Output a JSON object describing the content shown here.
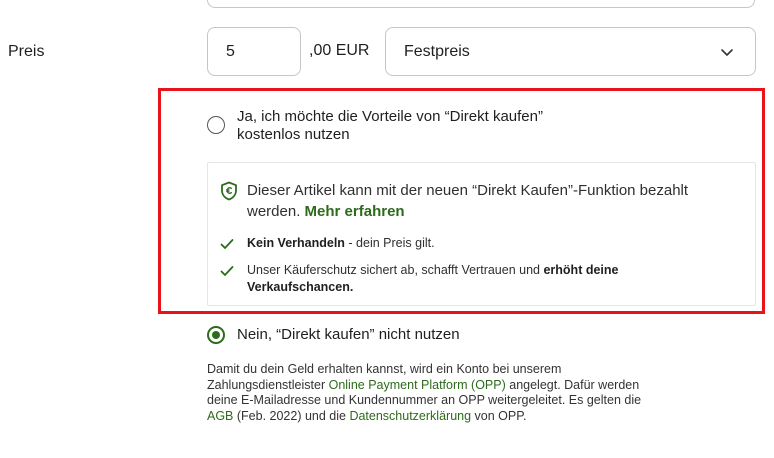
{
  "price": {
    "label": "Preis",
    "value": "5",
    "currency_suffix": ",00 EUR",
    "type_selected": "Festpreis"
  },
  "direkt_kaufen": {
    "option_yes_line1": "Ja, ich möchte die Vorteile von “Direkt kaufen”",
    "option_yes_line2": "kostenlos nutzen",
    "info_line1": "Dieser Artikel kann mit der neuen “Direkt Kaufen”-Funktion bezahlt",
    "info_line2": "werden.",
    "info_link": "Mehr erfahren",
    "feature1_bold": "Kein Verhandeln",
    "feature1_rest": " - dein Preis gilt.",
    "feature2_text": "Unser Käuferschutz sichert ab, schafft Vertrauen und ",
    "feature2_bold_line1": "erhöht deine",
    "feature2_bold_line2": "Verkaufschancen.",
    "option_no": "Nein, “Direkt kaufen” nicht nutzen",
    "selected": "no"
  },
  "legal": {
    "l1": "Damit du dein Geld erhalten kannst, wird ein Konto bei unserem",
    "l2_a": "Zahlungsdienstleister ",
    "l2_link": "Online Payment Platform (OPP)",
    "l2_b": " angelegt. Dafür werden",
    "l3": "deine E-Mailadresse und Kundennummer an OPP weitergeleitet. Es gelten die",
    "l4_link1": "AGB",
    "l4_a": " (Feb. 2022) und die ",
    "l4_link2": "Datenschutzerklärung",
    "l4_b": " von OPP."
  },
  "colors": {
    "accent_green": "#2d6b1c",
    "highlight_red": "#e8141b"
  },
  "icons": {
    "shield": "shield-euro-icon",
    "check": "check-icon",
    "chevron": "chevron-down-icon"
  }
}
